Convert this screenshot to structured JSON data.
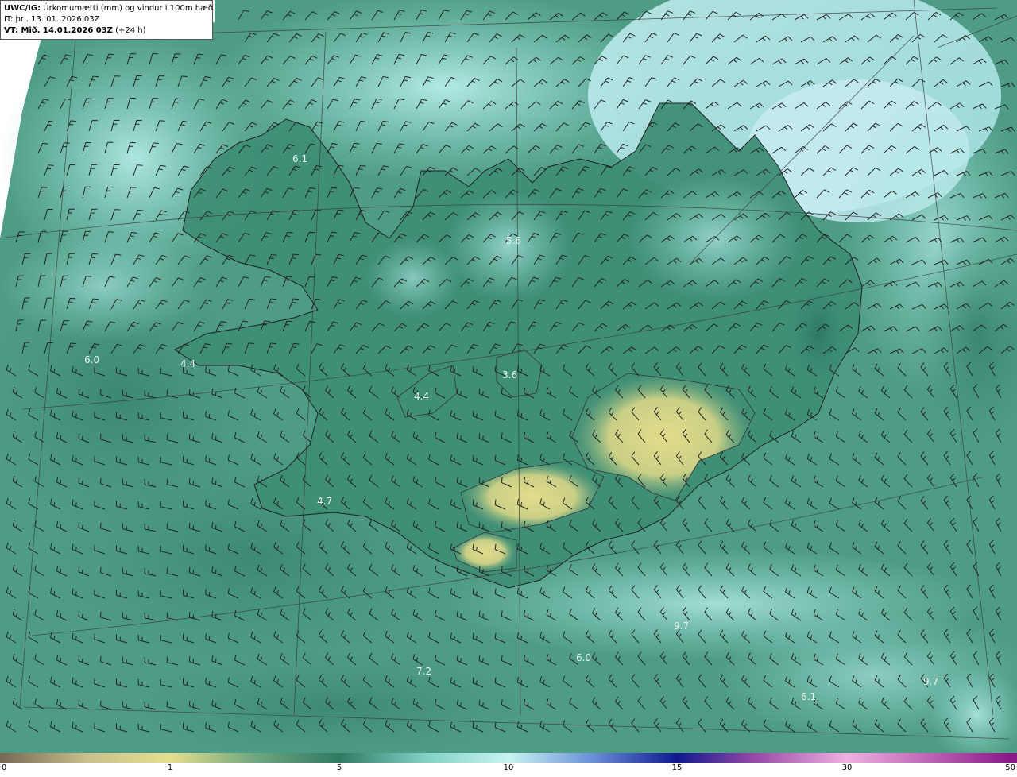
{
  "header": {
    "product_code": "UWC/IG:",
    "product_desc": "Úrkomumætti (mm) og vindur i 100m hæð",
    "init_time": "IT: þri. 13. 01. 2026 03Z",
    "valid_prefix": "VT: Mið. 14.01.2026 03Z",
    "valid_suffix": "(+24 h)"
  },
  "map_labels": [
    {
      "text": "6.1"
    },
    {
      "text": "5.6"
    },
    {
      "text": "6.0"
    },
    {
      "text": "4.4"
    },
    {
      "text": "4.4"
    },
    {
      "text": "3.6"
    },
    {
      "text": "4.7"
    },
    {
      "text": "7.2"
    },
    {
      "text": "6.0"
    },
    {
      "text": "6.1"
    },
    {
      "text": "9.7"
    },
    {
      "text": "9.7"
    }
  ],
  "colorbar": {
    "ticks": [
      "0",
      "1",
      "5",
      "10",
      "15",
      "30",
      "50"
    ],
    "stops": [
      {
        "value": 0,
        "color": "#7a6a55"
      },
      {
        "value": 0.5,
        "color": "#c8c08a"
      },
      {
        "value": 1,
        "color": "#e6de8c"
      },
      {
        "value": 3,
        "color": "#6fa77f"
      },
      {
        "value": 5,
        "color": "#2f7a63"
      },
      {
        "value": 7.5,
        "color": "#7fd0c4"
      },
      {
        "value": 10,
        "color": "#c8f4f0"
      },
      {
        "value": 12.5,
        "color": "#6a8fd8"
      },
      {
        "value": 15,
        "color": "#101890"
      },
      {
        "value": 22,
        "color": "#9a4aa8"
      },
      {
        "value": 30,
        "color": "#f0b0e0"
      },
      {
        "value": 50,
        "color": "#8a1a8a"
      }
    ]
  }
}
